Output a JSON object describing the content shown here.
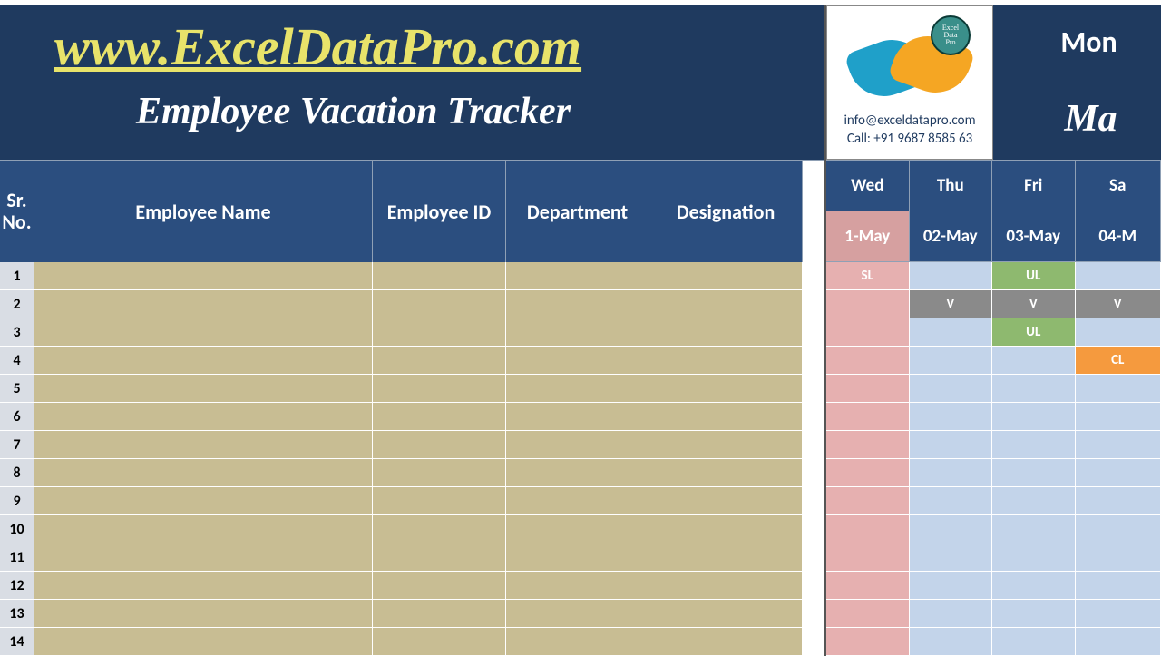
{
  "brand": {
    "title": "www.ExcelDataPro.com",
    "subtitle": "Employee Vacation Tracker"
  },
  "logo": {
    "badge_line1": "Excel",
    "badge_line2": "Data",
    "badge_line3": "Pro",
    "email": "info@exceldatapro.com",
    "phone": "Call: +91 9687 8585 63"
  },
  "month_block": {
    "label": "Mon",
    "value": "Ma"
  },
  "columns": {
    "sr": "Sr.\nNo.",
    "name": "Employee Name",
    "id": "Employee ID",
    "dept": "Department",
    "desg": "Designation"
  },
  "date_columns": [
    {
      "day": "Wed",
      "date": "1-May",
      "holiday": true
    },
    {
      "day": "Thu",
      "date": "02-May",
      "holiday": false
    },
    {
      "day": "Fri",
      "date": "03-May",
      "holiday": false
    },
    {
      "day": "Sa",
      "date": "04-M",
      "holiday": false
    }
  ],
  "row_numbers": [
    "1",
    "2",
    "3",
    "4",
    "5",
    "6",
    "7",
    "8",
    "9",
    "10",
    "11",
    "12",
    "13",
    "14"
  ],
  "calendar": [
    [
      "SL",
      "",
      "UL",
      ""
    ],
    [
      "",
      "V",
      "V",
      "V"
    ],
    [
      "",
      "",
      "UL",
      ""
    ],
    [
      "",
      "",
      "",
      "CL"
    ],
    [
      "",
      "",
      "",
      ""
    ],
    [
      "",
      "",
      "",
      ""
    ],
    [
      "",
      "",
      "",
      ""
    ],
    [
      "",
      "",
      "",
      ""
    ],
    [
      "",
      "",
      "",
      ""
    ],
    [
      "",
      "",
      "",
      ""
    ],
    [
      "",
      "",
      "",
      ""
    ],
    [
      "",
      "",
      "",
      ""
    ],
    [
      "",
      "",
      "",
      ""
    ],
    [
      "",
      "",
      "",
      ""
    ]
  ]
}
